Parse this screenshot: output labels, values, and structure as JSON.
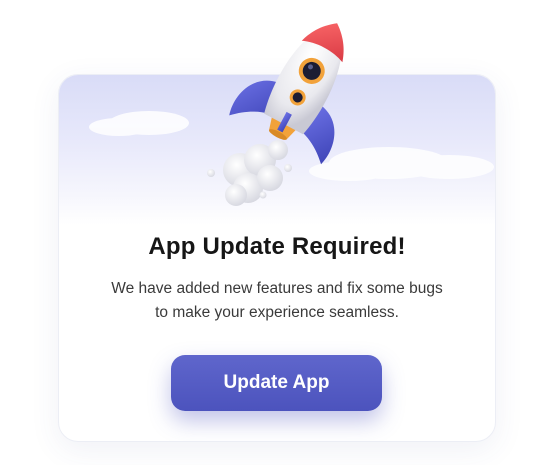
{
  "dialog": {
    "title": "App Update Required!",
    "message_line1": "We have added new features and fix some bugs",
    "message_line2": "to make your experience seamless.",
    "button_label": "Update App"
  },
  "illustration": {
    "icon": "rocket-icon",
    "smoke": "smoke-puff-icon"
  },
  "colors": {
    "accent": "#4f56c1",
    "rocket_body": "#f2f2f4",
    "rocket_nose": "#ef4b52",
    "rocket_fins": "#5b60d6",
    "window_ring": "#f2a23a",
    "title_text": "#161616",
    "body_text": "#3a3a3a"
  }
}
